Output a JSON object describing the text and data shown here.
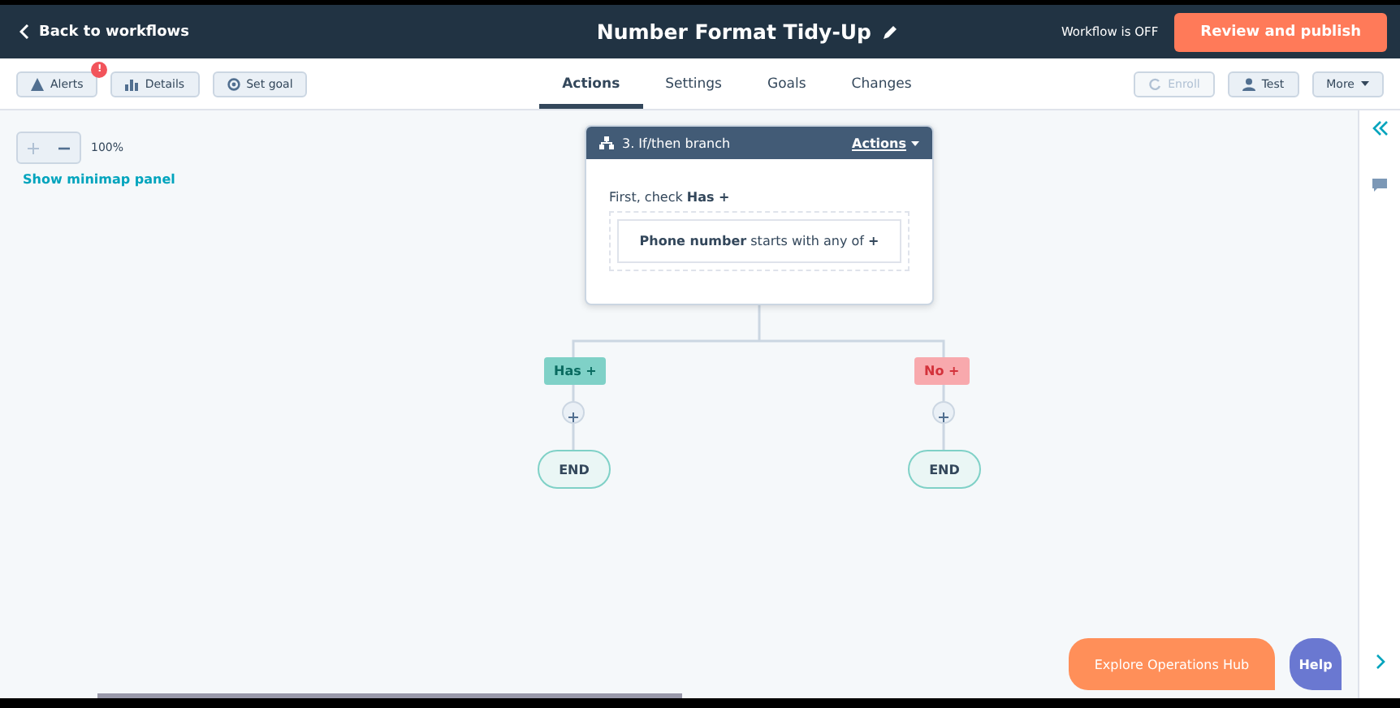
{
  "topbar": {
    "back_link": "Back to workflows",
    "title": "Number Format Tidy-Up",
    "status": "Workflow is OFF",
    "publish_button": "Review and publish"
  },
  "toolbar": {
    "left_buttons": [
      {
        "label": "Alerts",
        "kind": "alert",
        "badge": "!"
      },
      {
        "label": "Details",
        "kind": "details"
      },
      {
        "label": "Set goal",
        "kind": "goal"
      }
    ],
    "tabs": [
      {
        "label": "Actions",
        "selected": true
      },
      {
        "label": "Settings",
        "selected": false
      },
      {
        "label": "Goals",
        "selected": false
      },
      {
        "label": "Changes",
        "selected": false
      }
    ],
    "right_buttons": [
      {
        "label": "Enroll",
        "kind": "enroll",
        "disabled": true
      },
      {
        "label": "Test",
        "kind": "test",
        "disabled": false
      },
      {
        "label": "More",
        "kind": "more",
        "disabled": false
      }
    ]
  },
  "canvas": {
    "zoom": "100%",
    "minimap_link": "Show minimap panel",
    "action_card": {
      "title": "3. If/then branch",
      "menu": "Actions",
      "first_check": "First, check **Has +**",
      "condition": "**Phone number** starts with any of **+**"
    },
    "branches": [
      {
        "label": "Has +",
        "kind": "yes",
        "end": "END"
      },
      {
        "label": "No +",
        "kind": "no",
        "end": "END"
      }
    ]
  },
  "floating": {
    "explore_button": "Explore Operations Hub",
    "help_button": "Help"
  }
}
